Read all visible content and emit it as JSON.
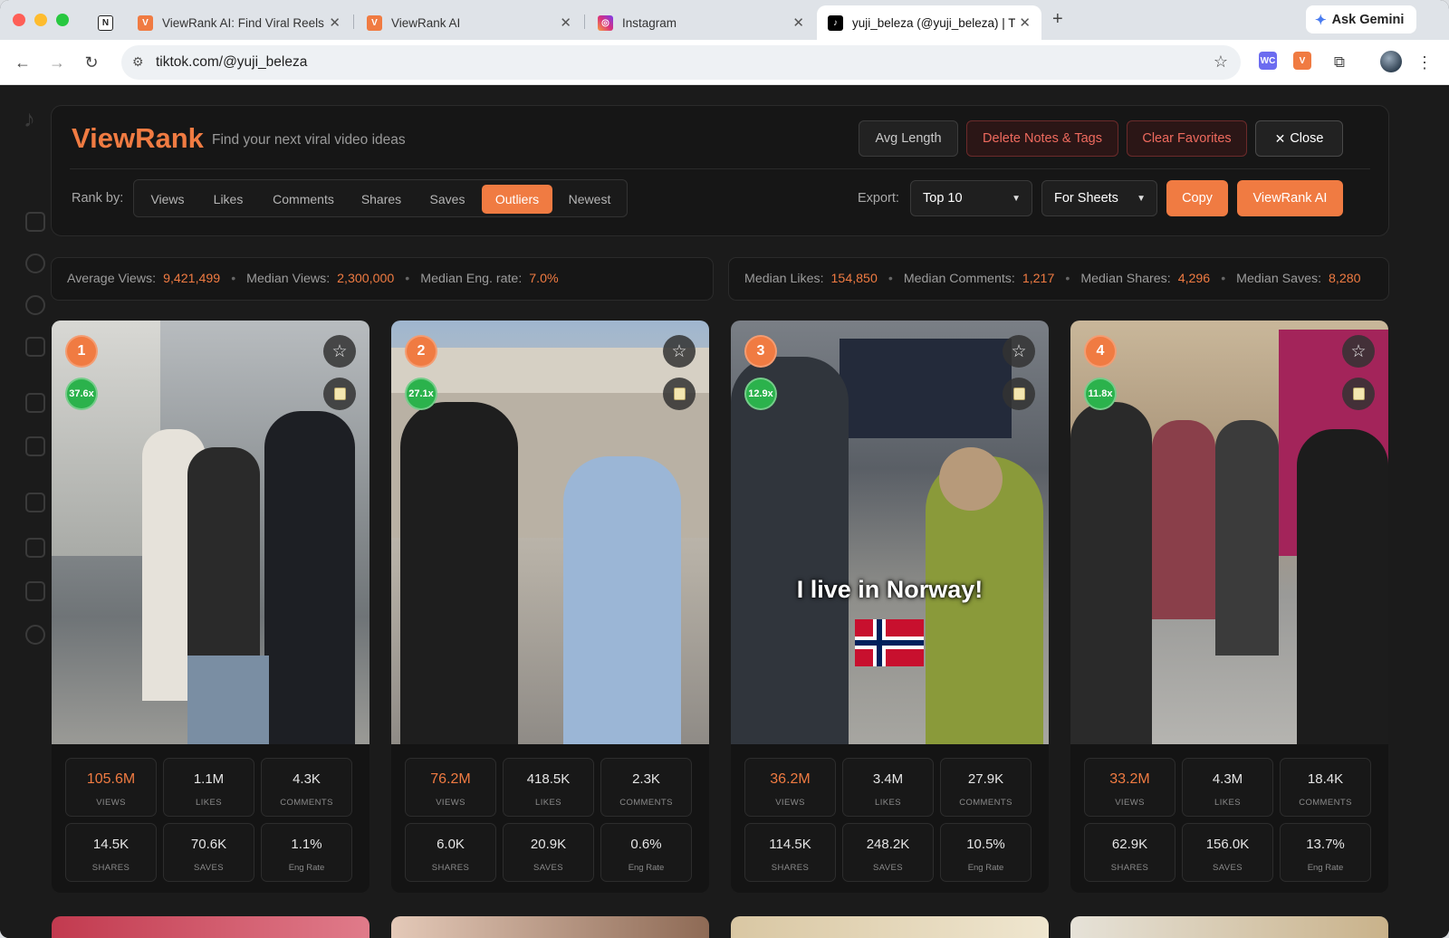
{
  "browser": {
    "tabs": [
      {
        "title": "ViewRank AI: Find Viral Reels",
        "icon": "viewrank-icon",
        "color": "#f07b42"
      },
      {
        "title": "ViewRank AI",
        "icon": "viewrank-icon",
        "color": "#f07b42"
      },
      {
        "title": "Instagram",
        "icon": "instagram-icon",
        "color": "#d8307d"
      },
      {
        "title": "yuji_beleza (@yuji_beleza) | T",
        "icon": "tiktok-icon",
        "color": "#000000"
      }
    ],
    "ask_gemini": "Ask Gemini",
    "url": "tiktok.com/@yuji_beleza",
    "ext_wc": "WC"
  },
  "viewrank": {
    "logo": "ViewRank",
    "tagline": "Find your next viral video ideas",
    "buttons": {
      "avg_length": "Avg Length",
      "delete_notes": "Delete Notes & Tags",
      "clear_favorites": "Clear Favorites",
      "close": "Close"
    },
    "rank_by_label": "Rank by:",
    "rank_options": [
      "Views",
      "Likes",
      "Comments",
      "Shares",
      "Saves",
      "Outliers",
      "Newest"
    ],
    "rank_selected": "Outliers",
    "export_label": "Export:",
    "export_count": "Top 10",
    "export_format": "For Sheets",
    "copy": "Copy",
    "viewrank_ai": "ViewRank AI",
    "stats_left": {
      "avg_views_label": "Average Views:",
      "avg_views": "9,421,499",
      "median_views_label": "Median Views:",
      "median_views": "2,300,000",
      "median_eng_label": "Median Eng. rate:",
      "median_eng": "7.0%"
    },
    "stats_right": {
      "median_likes_label": "Median Likes:",
      "median_likes": "154,850",
      "median_comments_label": "Median Comments:",
      "median_comments": "1,217",
      "median_shares_label": "Median Shares:",
      "median_shares": "4,296",
      "median_saves_label": "Median Saves:",
      "median_saves": "8,280"
    },
    "labels": {
      "views": "VIEWS",
      "likes": "LIKES",
      "comments": "COMMENTS",
      "shares": "SHARES",
      "saves": "SAVES",
      "eng": "Eng Rate"
    },
    "videos": [
      {
        "rank": "1",
        "multiplier": "37.6x",
        "views": "105.6M",
        "likes": "1.1M",
        "comments": "4.3K",
        "shares": "14.5K",
        "saves": "70.6K",
        "eng": "1.1%",
        "overlay": ""
      },
      {
        "rank": "2",
        "multiplier": "27.1x",
        "views": "76.2M",
        "likes": "418.5K",
        "comments": "2.3K",
        "shares": "6.0K",
        "saves": "20.9K",
        "eng": "0.6%",
        "overlay": ""
      },
      {
        "rank": "3",
        "multiplier": "12.9x",
        "views": "36.2M",
        "likes": "3.4M",
        "comments": "27.9K",
        "shares": "114.5K",
        "saves": "248.2K",
        "eng": "10.5%",
        "overlay": "I live in Norway!"
      },
      {
        "rank": "4",
        "multiplier": "11.8x",
        "views": "33.2M",
        "likes": "4.3M",
        "comments": "18.4K",
        "shares": "62.9K",
        "saves": "156.0K",
        "eng": "13.7%",
        "overlay": ""
      }
    ]
  },
  "colors": {
    "accent": "#f07b42",
    "outlier_green": "#2bb24c",
    "danger": "#ee6a5e"
  }
}
